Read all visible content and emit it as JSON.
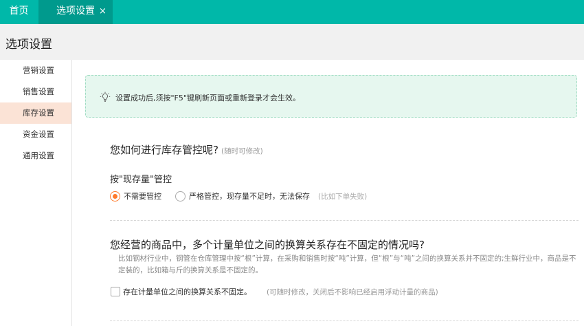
{
  "topbar": {
    "home_label": "首页",
    "active_tab_label": "选项设置",
    "tab_close": "×"
  },
  "page": {
    "title": "选项设置"
  },
  "sidebar": {
    "items": [
      {
        "label": "营销设置",
        "active": false
      },
      {
        "label": "销售设置",
        "active": false
      },
      {
        "label": "库存设置",
        "active": true
      },
      {
        "label": "资金设置",
        "active": false
      },
      {
        "label": "通用设置",
        "active": false
      }
    ]
  },
  "tip": {
    "text": "设置成功后,须按\"F5\"键刷新页面或重新登录才会生效。",
    "icon": "lightbulb-icon"
  },
  "section1": {
    "question": "您如何进行库存管控呢?",
    "hint": "(随时可修改)",
    "subtitle": "按\"现存量\"管控",
    "options": [
      {
        "label": "不需要管控",
        "checked": true
      },
      {
        "label": "严格管控，现存量不足时，无法保存",
        "checked": false
      }
    ],
    "option_note": "(比如下单失败)"
  },
  "section2": {
    "question": "您经营的商品中，多个计量单位之间的换算关系存在不固定的情况吗?",
    "description": "比如钢材行业中，钢管在仓库管理中按“根”计算，在采购和销售时按“吨”计算，但“根”与“吨”之间的换算关系并不固定的;生鲜行业中，商品是不定装的，比如箱与斤的换算关系是不固定的。",
    "checkbox_label": "存在计量单位之间的换算关系不固定。",
    "checkbox_checked": false,
    "checkbox_note": "(可随时修改，关闭后不影响已经启用浮动计量的商品)"
  },
  "colors": {
    "accent": "#00b8a9",
    "active_tab": "#009a8d",
    "radio": "#ff7a2b",
    "sidebar_active": "#fbe3d6",
    "tip_bg": "#e6f7ef"
  }
}
